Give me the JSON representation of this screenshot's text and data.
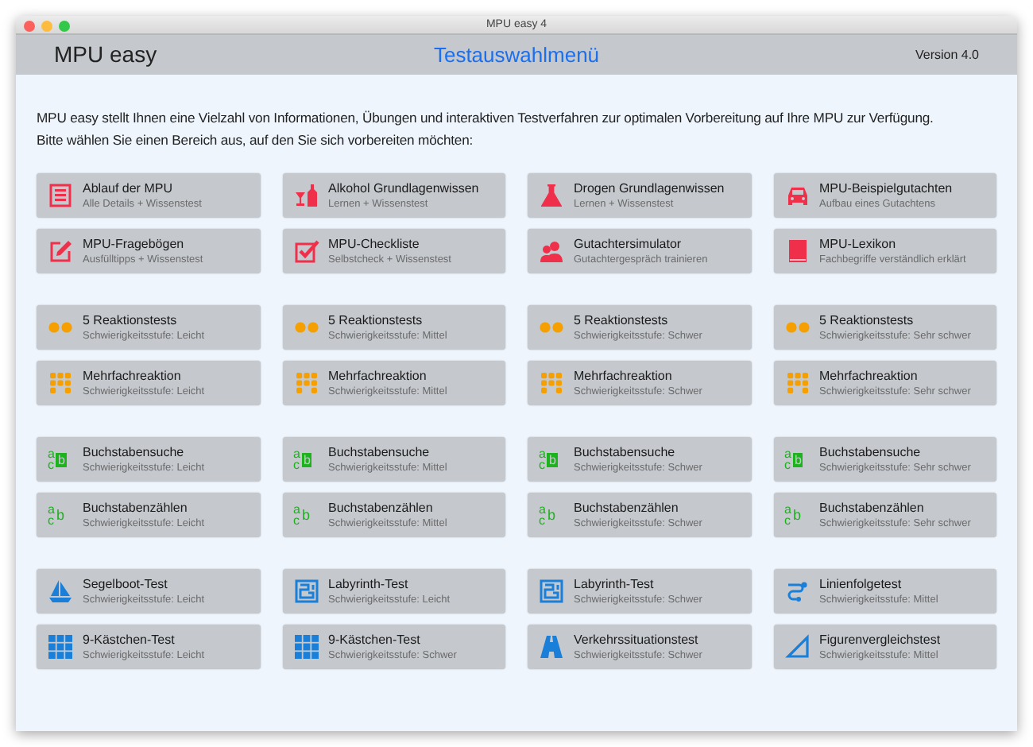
{
  "window": {
    "title": "MPU easy 4"
  },
  "header": {
    "app_name": "MPU easy",
    "title": "Testauswahlmenü",
    "version": "Version 4.0"
  },
  "intro": [
    "MPU easy stellt Ihnen eine Vielzahl von Informationen, Übungen und interaktiven Testverfahren zur optimalen Vorbereitung auf Ihre MPU zur Verfügung.",
    "Bitte wählen Sie einen Bereich aus, auf den Sie sich vorbereiten möchten:"
  ],
  "groups": [
    [
      {
        "kind": "list",
        "title": "Ablauf der MPU",
        "subtitle": "Alle Details + Wissenstest"
      },
      {
        "kind": "bottle",
        "title": "Alkohol Grundlagenwissen",
        "subtitle": "Lernen + Wissenstest"
      },
      {
        "kind": "flask",
        "title": "Drogen Grundlagenwissen",
        "subtitle": "Lernen + Wissenstest"
      },
      {
        "kind": "car",
        "title": "MPU-Beispielgutachten",
        "subtitle": "Aufbau eines Gutachtens"
      },
      {
        "kind": "edit",
        "title": "MPU-Fragebögen",
        "subtitle": "Ausfülltipps + Wissenstest"
      },
      {
        "kind": "check",
        "title": "MPU-Checkliste",
        "subtitle": "Selbstcheck + Wissenstest"
      },
      {
        "kind": "people",
        "title": "Gutachtersimulator",
        "subtitle": "Gutachtergespräch trainieren"
      },
      {
        "kind": "book",
        "title": "MPU-Lexikon",
        "subtitle": "Fachbegriffe verständlich erklärt"
      }
    ],
    [
      {
        "kind": "dots",
        "title": "5 Reaktionstests",
        "subtitle": "Schwierigkeitsstufe: Leicht"
      },
      {
        "kind": "dots",
        "title": "5 Reaktionstests",
        "subtitle": "Schwierigkeitsstufe: Mittel"
      },
      {
        "kind": "dots",
        "title": "5 Reaktionstests",
        "subtitle": "Schwierigkeitsstufe: Schwer"
      },
      {
        "kind": "dots",
        "title": "5 Reaktionstests",
        "subtitle": "Schwierigkeitsstufe: Sehr schwer"
      },
      {
        "kind": "dotgrid",
        "title": "Mehrfachreaktion",
        "subtitle": "Schwierigkeitsstufe: Leicht"
      },
      {
        "kind": "dotgrid",
        "title": "Mehrfachreaktion",
        "subtitle": "Schwierigkeitsstufe: Mittel"
      },
      {
        "kind": "dotgrid",
        "title": "Mehrfachreaktion",
        "subtitle": "Schwierigkeitsstufe: Schwer"
      },
      {
        "kind": "dotgrid",
        "title": "Mehrfachreaktion",
        "subtitle": "Schwierigkeitsstufe: Sehr schwer"
      }
    ],
    [
      {
        "kind": "letters-box",
        "icon_letters": [
          "a",
          "c",
          "b"
        ],
        "title": "Buchstabensuche",
        "subtitle": "Schwierigkeitsstufe: Leicht"
      },
      {
        "kind": "letters-box",
        "icon_letters": [
          "a",
          "c",
          "b"
        ],
        "title": "Buchstabensuche",
        "subtitle": "Schwierigkeitsstufe: Mittel"
      },
      {
        "kind": "letters-box",
        "icon_letters": [
          "a",
          "c",
          "b"
        ],
        "title": "Buchstabensuche",
        "subtitle": "Schwierigkeitsstufe: Schwer"
      },
      {
        "kind": "letters-box",
        "icon_letters": [
          "a",
          "c",
          "b"
        ],
        "title": "Buchstabensuche",
        "subtitle": "Schwierigkeitsstufe: Sehr schwer"
      },
      {
        "kind": "letters",
        "icon_letters": [
          "a",
          "c",
          "b"
        ],
        "title": "Buchstabenzählen",
        "subtitle": "Schwierigkeitsstufe: Leicht"
      },
      {
        "kind": "letters",
        "icon_letters": [
          "a",
          "c",
          "b"
        ],
        "title": "Buchstabenzählen",
        "subtitle": "Schwierigkeitsstufe: Mittel"
      },
      {
        "kind": "letters",
        "icon_letters": [
          "a",
          "c",
          "b"
        ],
        "title": "Buchstabenzählen",
        "subtitle": "Schwierigkeitsstufe: Schwer"
      },
      {
        "kind": "letters",
        "icon_letters": [
          "a",
          "c",
          "b"
        ],
        "title": "Buchstabenzählen",
        "subtitle": "Schwierigkeitsstufe: Sehr schwer"
      }
    ],
    [
      {
        "kind": "boat",
        "title": "Segelboot-Test",
        "subtitle": "Schwierigkeitsstufe: Leicht"
      },
      {
        "kind": "maze",
        "title": "Labyrinth-Test",
        "subtitle": "Schwierigkeitsstufe: Leicht"
      },
      {
        "kind": "maze",
        "title": "Labyrinth-Test",
        "subtitle": "Schwierigkeitsstufe: Schwer"
      },
      {
        "kind": "line",
        "title": "Linienfolgetest",
        "subtitle": "Schwierigkeitsstufe: Mittel"
      },
      {
        "kind": "squares",
        "title": "9-Kästchen-Test",
        "subtitle": "Schwierigkeitsstufe: Leicht"
      },
      {
        "kind": "squares",
        "title": "9-Kästchen-Test",
        "subtitle": "Schwierigkeitsstufe: Schwer"
      },
      {
        "kind": "road",
        "title": "Verkehrssituationstest",
        "subtitle": "Schwierigkeitsstufe: Schwer"
      },
      {
        "kind": "triangle",
        "title": "Figurenvergleichstest",
        "subtitle": "Schwierigkeitsstufe: Mittel"
      }
    ]
  ]
}
